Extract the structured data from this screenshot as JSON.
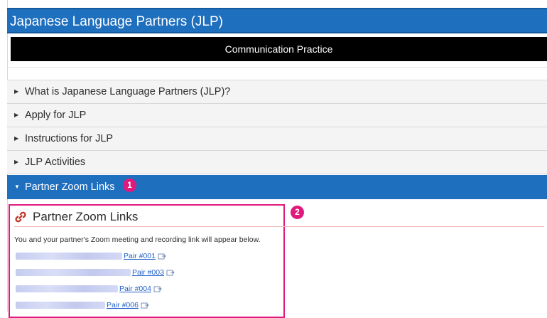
{
  "header": {
    "title": "Japanese Language Partners (JLP)"
  },
  "subnav": {
    "label": "Communication Practice"
  },
  "accordion": [
    {
      "label": "What is Japanese Language Partners (JLP)?",
      "expanded": false
    },
    {
      "label": "Apply for JLP",
      "expanded": false
    },
    {
      "label": "Instructions for JLP",
      "expanded": false
    },
    {
      "label": "JLP Activities",
      "expanded": false
    },
    {
      "label": "Partner Zoom Links",
      "expanded": true
    }
  ],
  "annotations": {
    "badge1": "1",
    "badge2": "2",
    "accent": "#e0197d"
  },
  "section": {
    "heading": "Partner Zoom Links",
    "description": "You and your partner's Zoom meeting and recording link will appear below.",
    "pairs": [
      {
        "label": "Pair #001"
      },
      {
        "label": "Pair #003"
      },
      {
        "label": "Pair #004"
      },
      {
        "label": "Pair #006"
      }
    ]
  },
  "colors": {
    "primary": "#1f6fbf",
    "link": "#1f5fc9",
    "bar": "#000000"
  },
  "icons": {
    "heading": "link-icon",
    "external": "external-link-icon",
    "expand": "caret-right-icon",
    "collapse": "caret-down-icon"
  }
}
